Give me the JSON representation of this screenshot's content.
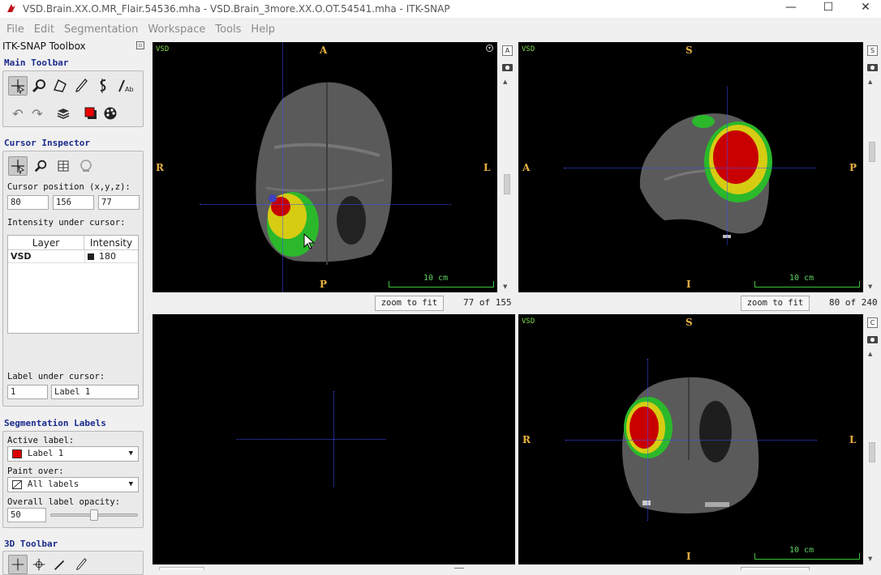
{
  "window": {
    "title": "VSD.Brain.XX.O.MR_Flair.54536.mha - VSD.Brain_3more.XX.O.OT.54541.mha - ITK-SNAP",
    "minimize": "—",
    "maximize": "☐",
    "close": "✕"
  },
  "menu": [
    "File",
    "Edit",
    "Segmentation",
    "Workspace",
    "Tools",
    "Help"
  ],
  "toolbox": {
    "title": "ITK-SNAP Toolbox",
    "main_toolbar_title": "Main Toolbar",
    "cursor_inspector_title": "Cursor Inspector",
    "cursor_position_label": "Cursor position (x,y,z):",
    "cursor_x": "80",
    "cursor_y": "156",
    "cursor_z": "77",
    "intensity_label": "Intensity under cursor:",
    "table_headers": [
      "Layer",
      "Intensity"
    ],
    "table_rows": [
      {
        "layer": "VSD",
        "intensity": "180",
        "swatch": "#222222"
      }
    ],
    "label_under_cursor": "Label under cursor:",
    "label_id": "1",
    "label_name": "Label 1",
    "segmentation_labels_title": "Segmentation Labels",
    "active_label_caption": "Active label:",
    "active_label_value": "Label 1",
    "active_label_color": "#e00000",
    "paint_over_caption": "Paint over:",
    "paint_over_value": "All labels",
    "opacity_caption": "Overall label opacity:",
    "opacity_value": "50",
    "opacity_fraction": 0.5,
    "toolbar3d_title": "3D Toolbar"
  },
  "views": {
    "axial": {
      "label": "VSD",
      "top": "A",
      "bottom": "P",
      "left": "R",
      "right": "L",
      "scale": "10 cm",
      "zoom": "zoom to fit",
      "slice": "77 of 155",
      "side_button": "A"
    },
    "sagittal": {
      "label": "VSD",
      "top": "S",
      "bottom": "I",
      "left": "A",
      "right": "P",
      "scale": "10 cm",
      "zoom": "zoom to fit",
      "slice": "80 of 240",
      "side_button": "S"
    },
    "render3d": {
      "label": ""
    },
    "coronal": {
      "label": "VSD",
      "top": "S",
      "bottom": "I",
      "left": "R",
      "right": "L",
      "scale": "10 cm",
      "side_button": "C"
    }
  },
  "colors": {
    "orientation": "#e8b040",
    "overlay_text": "#7fdc4a",
    "crosshair": "#3a4cff",
    "section_title": "#1a2a8c",
    "label_red": "#c80000",
    "label_yellow": "#d8cc10",
    "label_green": "#2ec82e"
  }
}
